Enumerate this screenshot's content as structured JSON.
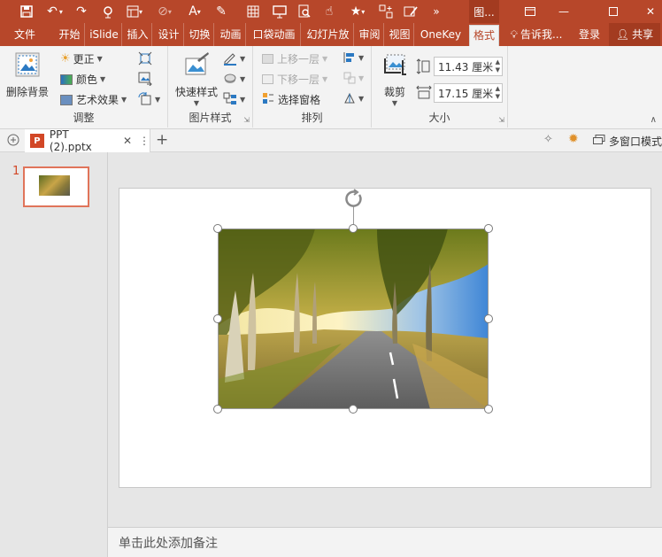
{
  "qat": {
    "picture_tools_label": "图...",
    "icons": [
      "save-icon",
      "undo-icon",
      "redo-icon",
      "present-icon",
      "layout-icon",
      "shape-icon",
      "text-icon",
      "table-icon",
      "slideshow-icon",
      "find-icon",
      "touch-icon",
      "star-icon",
      "add-icon",
      "brush-icon",
      "more-icon"
    ]
  },
  "tabs": {
    "file": "文件",
    "home": "开始",
    "islide": "iSlide",
    "insert": "插入",
    "design": "设计",
    "transitions": "切换",
    "animations": "动画",
    "pocket_animation": "口袋动画",
    "slideshow": "幻灯片放映",
    "review": "审阅",
    "view": "视图",
    "onekey": "OneKey 1",
    "format": "格式",
    "tell_me": "告诉我...",
    "login": "登录",
    "share": "共享"
  },
  "ribbon": {
    "adjust": {
      "label": "调整",
      "remove_bg": "删除背景",
      "corrections": "更正",
      "color": "颜色",
      "artistic": "艺术效果"
    },
    "styles": {
      "label": "图片样式",
      "quick_styles": "快速样式"
    },
    "arrange": {
      "label": "排列",
      "bring_forward": "上移一层",
      "send_backward": "下移一层",
      "selection_pane": "选择窗格"
    },
    "size": {
      "label": "大小",
      "crop": "裁剪",
      "height": "11.43 厘米",
      "width": "17.15 厘米"
    }
  },
  "doc": {
    "filename": "PPT (2).pptx",
    "multiwindow": "多窗口模式"
  },
  "thumbs": {
    "slide_number": "1"
  },
  "notes": {
    "placeholder": "单击此处添加备注"
  },
  "colors": {
    "accent": "#b7472a",
    "ribbon_bg": "#f3f3f3",
    "thumb_selected": "#e0745a"
  }
}
